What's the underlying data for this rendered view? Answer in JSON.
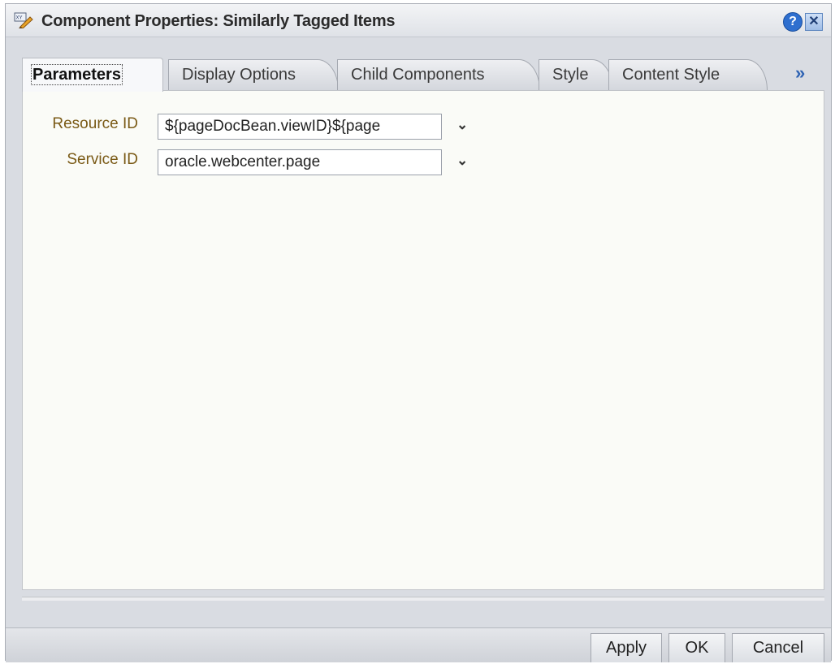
{
  "dialog": {
    "title": "Component Properties: Similarly Tagged Items",
    "title_icon": "edit-properties-icon",
    "help_label": "?",
    "close_label": "✕"
  },
  "tabs": [
    {
      "label": "Parameters",
      "active": true
    },
    {
      "label": "Display Options",
      "active": false
    },
    {
      "label": "Child Components",
      "active": false
    },
    {
      "label": "Style",
      "active": false
    },
    {
      "label": "Content Style",
      "active": false
    }
  ],
  "more_tabs_label": "»",
  "fields": [
    {
      "label": "Resource ID",
      "value": "${pageDocBean.viewID}${page"
    },
    {
      "label": "Service ID",
      "value": "oracle.webcenter.page"
    }
  ],
  "dropdown_glyph": "⌄",
  "buttons": {
    "apply": "Apply",
    "ok": "OK",
    "cancel": "Cancel"
  },
  "colors": {
    "label": "#7a5a16",
    "accent": "#2e6fcf"
  }
}
